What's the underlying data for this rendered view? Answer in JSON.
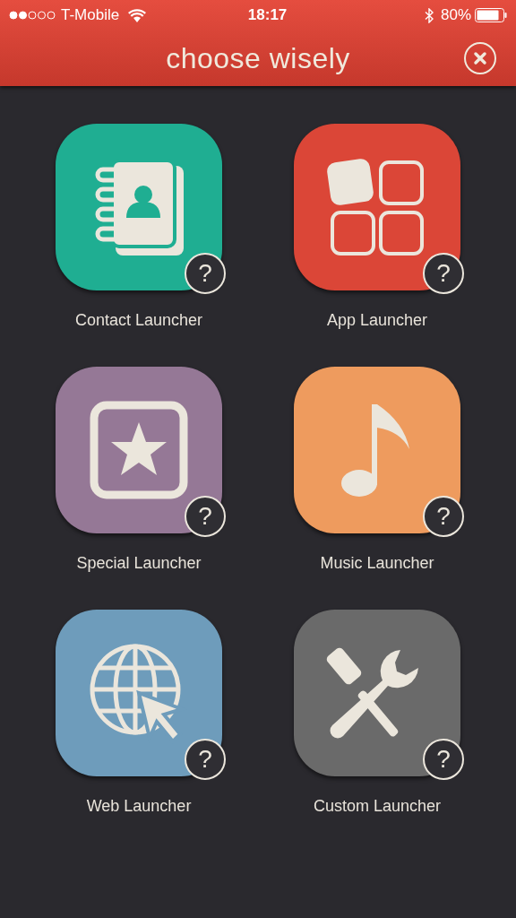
{
  "status_bar": {
    "carrier": "T-Mobile",
    "time": "18:17",
    "battery": "80%"
  },
  "header": {
    "title": "choose wisely"
  },
  "launchers": [
    {
      "kind": "contact",
      "label": "Contact Launcher",
      "color": "#1fae92",
      "help": "?"
    },
    {
      "kind": "app",
      "label": "App Launcher",
      "color": "#db4637",
      "help": "?"
    },
    {
      "kind": "special",
      "label": "Special Launcher",
      "color": "#957896",
      "help": "?"
    },
    {
      "kind": "music",
      "label": "Music Launcher",
      "color": "#ee9b5e",
      "help": "?"
    },
    {
      "kind": "web",
      "label": "Web Launcher",
      "color": "#6e9cbb",
      "help": "?"
    },
    {
      "kind": "custom",
      "label": "Custom Launcher",
      "color": "#6a6a6a",
      "help": "?"
    }
  ]
}
